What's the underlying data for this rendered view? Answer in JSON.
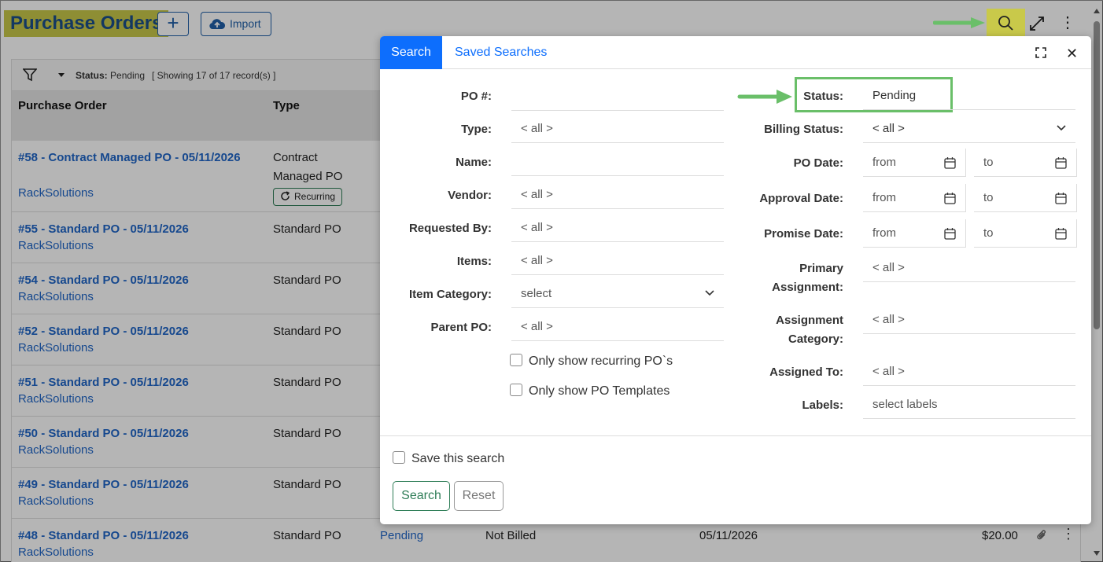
{
  "header": {
    "title": "Purchase Orders",
    "add_label": "+",
    "import_label": "Import"
  },
  "toolbar": {
    "status_label": "Status:",
    "status_value": "Pending",
    "showing": "[ Showing 17 of 17 record(s) ]"
  },
  "table": {
    "headers": [
      "Purchase Order",
      "Type"
    ],
    "rows": [
      {
        "po": "#58 - Contract Managed PO - 05/11/2026",
        "vendor": "RackSolutions",
        "type": "Contract Managed PO",
        "badge": "Recurring"
      },
      {
        "po": "#55 - Standard PO - 05/11/2026",
        "vendor": "RackSolutions",
        "type": "Standard PO"
      },
      {
        "po": "#54 - Standard PO - 05/11/2026",
        "vendor": "RackSolutions",
        "type": "Standard PO"
      },
      {
        "po": "#52 - Standard PO - 05/11/2026",
        "vendor": "RackSolutions",
        "type": "Standard PO"
      },
      {
        "po": "#51 - Standard PO - 05/11/2026",
        "vendor": "RackSolutions",
        "type": "Standard PO"
      },
      {
        "po": "#50 - Standard PO - 05/11/2026",
        "vendor": "RackSolutions",
        "type": "Standard PO"
      },
      {
        "po": "#49 - Standard PO - 05/11/2026",
        "vendor": "RackSolutions",
        "type": "Standard PO"
      },
      {
        "po": "#48 - Standard PO - 05/11/2026",
        "vendor": "RackSolutions",
        "type": "Standard PO",
        "status": "Pending",
        "billing": "Not Billed",
        "date": "05/11/2026",
        "amount": "$20.00"
      }
    ]
  },
  "modal": {
    "tabs": [
      "Search",
      "Saved Searches"
    ],
    "left": {
      "po_label": "PO #:",
      "po_value": "",
      "type_label": "Type:",
      "type_value": "< all >",
      "name_label": "Name:",
      "name_value": "",
      "vendor_label": "Vendor:",
      "vendor_value": "< all >",
      "requested_label": "Requested By:",
      "requested_value": "< all >",
      "items_label": "Items:",
      "items_value": "< all >",
      "itemcat_label": "Item Category:",
      "itemcat_value": "select",
      "parent_label": "Parent PO:",
      "parent_value": "< all >",
      "recurring_label": "Only show recurring PO`s",
      "templates_label": "Only show PO Templates"
    },
    "right": {
      "status_label": "Status:",
      "status_value": "Pending",
      "billing_label": "Billing Status:",
      "billing_value": "< all >",
      "podate_label": "PO Date:",
      "approval_label": "Approval Date:",
      "promise_label": "Promise Date:",
      "from": "from",
      "to": "to",
      "primary_label_1": "Primary",
      "primary_label_2": "Assignment:",
      "primary_value": "< all >",
      "assigncat_label_1": "Assignment",
      "assigncat_label_2": "Category:",
      "assigncat_value": "< all >",
      "assigned_label": "Assigned To:",
      "assigned_value": "< all >",
      "labels_label": "Labels:",
      "labels_value": "select labels"
    },
    "save_search_label": "Save this search",
    "search_button": "Search",
    "reset_button": "Reset"
  },
  "colors": {
    "primary": "#0d6efd",
    "link": "#1f66c8",
    "highlight": "#c9c94a",
    "annotation_green": "#6abf69",
    "success": "#2e7d57"
  },
  "icons": [
    "plus-icon",
    "cloud-upload-icon",
    "search-icon",
    "expand-icon",
    "kebab-icon",
    "filter-icon",
    "refresh-icon",
    "paperclip-icon",
    "fullscreen-icon",
    "close-icon",
    "chevron-down-icon",
    "calendar-icon",
    "arrow-annotation"
  ]
}
